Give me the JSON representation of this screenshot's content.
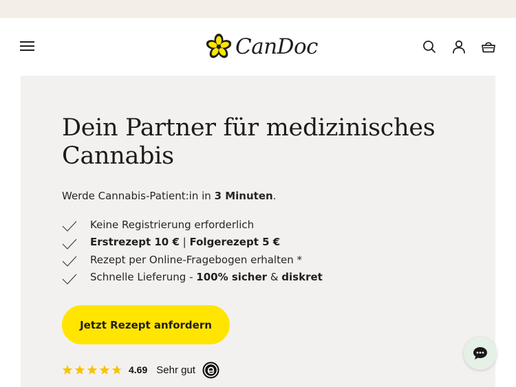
{
  "brand": {
    "name": "CanDoc",
    "accent": "#ffe500",
    "logo_color": "#1f1f1f"
  },
  "header": {
    "menu_icon": "hamburger-menu-icon",
    "actions": [
      "search-icon",
      "account-icon",
      "cart-icon"
    ]
  },
  "hero": {
    "headline": "Dein Partner für medizinisches Cannabis",
    "subline_prefix": "Werde Cannabis-Patient:in in ",
    "subline_bold": "3 Minuten",
    "subline_suffix": ".",
    "benefits": [
      {
        "text": "Keine Registrierung erforderlich"
      },
      {
        "bold1": "Erstrezept 10 €",
        "sep": " | ",
        "bold2": "Folgerezept 5 €"
      },
      {
        "text": "Rezept per Online-Fragebogen erhalten *"
      },
      {
        "pre": "Schnelle Lieferung - ",
        "bold1": "100% sicher",
        "mid": " & ",
        "bold2": "diskret"
      }
    ],
    "cta_label": "Jetzt Rezept anfordern",
    "rating": {
      "value": "4.69",
      "label": "Sehr gut",
      "stars": 4.69,
      "star_color": "#f7c300"
    }
  },
  "chat": {
    "icon": "chat-bubble-icon"
  }
}
